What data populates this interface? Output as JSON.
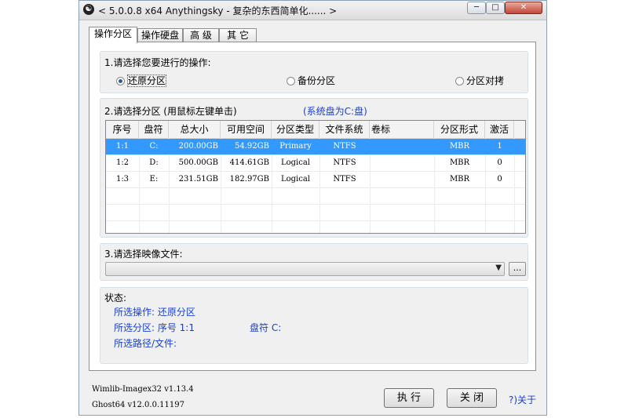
{
  "window": {
    "title": "< 5.0.0.8 x64 Anythingsky - 复杂的东西简单化...... >",
    "app_icon": "yin-yang-icon",
    "min_label": "─",
    "max_label": "□",
    "close_label": "✕"
  },
  "tabs": [
    {
      "label": "操作分区",
      "active": true
    },
    {
      "label": "操作硬盘",
      "active": false
    },
    {
      "label": "高 级",
      "active": false
    },
    {
      "label": "其 它",
      "active": false
    }
  ],
  "section1": {
    "label": "1.请选择您要进行的操作:",
    "options": [
      {
        "label": "还原分区",
        "selected": true
      },
      {
        "label": "备份分区",
        "selected": false
      },
      {
        "label": "分区对拷",
        "selected": false
      }
    ]
  },
  "section2": {
    "label": "2.请选择分区 (用鼠标左键单击)",
    "system_disk": "(系统盘为C:盘)",
    "columns": [
      "序号",
      "盘符",
      "总大小",
      "可用空间",
      "分区类型",
      "文件系统",
      "卷标",
      "分区形式",
      "激活"
    ],
    "rows": [
      {
        "cells": [
          "1:1",
          "C:",
          "200.00GB",
          "54.92GB",
          "Primary",
          "NTFS",
          "",
          "MBR",
          "1"
        ],
        "selected": true
      },
      {
        "cells": [
          "1:2",
          "D:",
          "500.00GB",
          "414.61GB",
          "Logical",
          "NTFS",
          "",
          "MBR",
          "0"
        ],
        "selected": false
      },
      {
        "cells": [
          "1:3",
          "E:",
          "231.51GB",
          "182.97GB",
          "Logical",
          "NTFS",
          "",
          "MBR",
          "0"
        ],
        "selected": false
      }
    ]
  },
  "section3": {
    "label": "3.请选择映像文件:",
    "combo_value": "",
    "combo_arrow": "▼",
    "browse_label": "..."
  },
  "status": {
    "label": "状态:",
    "operation": "所选操作: 还原分区",
    "partition": "所选分区:   序号 1:1",
    "drive": "盘符 C:",
    "path": "所选路径/文件:"
  },
  "footer": {
    "wimlib": "Wimlib-Imagex32 v1.13.4",
    "ghost": "Ghost64 v12.0.0.11197",
    "execute_label": "执 行",
    "close_label": "关 闭",
    "about_label": "?)关于"
  },
  "colors": {
    "selection": "#3399ff",
    "link_blue": "#1a3fd0"
  }
}
